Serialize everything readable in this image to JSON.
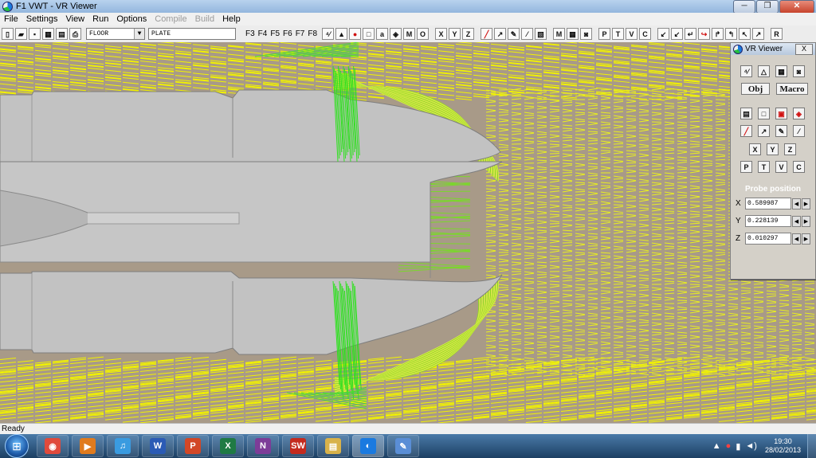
{
  "window": {
    "title": "F1 VWT - VR Viewer",
    "minimize": "─",
    "maximize": "❐",
    "close": "✕"
  },
  "menu": [
    {
      "label": "File",
      "enabled": true
    },
    {
      "label": "Settings",
      "enabled": true
    },
    {
      "label": "View",
      "enabled": true
    },
    {
      "label": "Run",
      "enabled": true
    },
    {
      "label": "Options",
      "enabled": true
    },
    {
      "label": "Compile",
      "enabled": false
    },
    {
      "label": "Build",
      "enabled": false
    },
    {
      "label": "Help",
      "enabled": true
    }
  ],
  "toolbar": {
    "file_buttons": [
      {
        "name": "new-file-icon",
        "glyph": "▯"
      },
      {
        "name": "open-folder-icon",
        "glyph": "▰"
      },
      {
        "name": "save-icon",
        "glyph": "▪"
      },
      {
        "name": "image-icon",
        "glyph": "▦"
      },
      {
        "name": "print-preview-icon",
        "glyph": "▤"
      },
      {
        "name": "print-icon",
        "glyph": "⎙"
      }
    ],
    "surface_select": "FLOOR",
    "object_field": "PLATE",
    "fkeys": [
      "F3",
      "F4",
      "F5",
      "F6",
      "F7",
      "F8"
    ],
    "tools": [
      {
        "name": "draw-mode-icon",
        "glyph": "⁴⁄"
      },
      {
        "name": "paint-icon",
        "glyph": "▲"
      },
      {
        "name": "red-marker-icon",
        "glyph": "●"
      },
      {
        "name": "select-box-icon",
        "glyph": "□"
      },
      {
        "name": "lock-icon",
        "glyph": "a"
      },
      {
        "name": "cube-icon",
        "glyph": "◈"
      },
      {
        "name": "m-button",
        "glyph": "M"
      },
      {
        "name": "o-button",
        "glyph": "O"
      },
      {
        "name": "x-axis-button",
        "glyph": "X"
      },
      {
        "name": "y-axis-button",
        "glyph": "Y"
      },
      {
        "name": "z-axis-button",
        "glyph": "Z"
      },
      {
        "name": "red-brush-icon",
        "glyph": "╱"
      },
      {
        "name": "arrow-tool-icon",
        "glyph": "↗"
      },
      {
        "name": "pencil-icon",
        "glyph": "✎"
      },
      {
        "name": "brush-icon",
        "glyph": "⁄"
      },
      {
        "name": "box-3d-icon",
        "glyph": "▧"
      },
      {
        "name": "macro-m-button",
        "glyph": "M"
      },
      {
        "name": "grid-icon",
        "glyph": "▦"
      },
      {
        "name": "camera-icon",
        "glyph": "◙"
      },
      {
        "name": "p-button",
        "glyph": "P"
      },
      {
        "name": "t-button",
        "glyph": "T"
      },
      {
        "name": "v-button",
        "glyph": "V"
      },
      {
        "name": "c-button",
        "glyph": "C"
      },
      {
        "name": "rotate-left-icon",
        "glyph": "↙"
      },
      {
        "name": "rotate-down-icon",
        "glyph": "↙"
      },
      {
        "name": "undo-icon",
        "glyph": "↵"
      },
      {
        "name": "redo-icon",
        "glyph": "↪"
      },
      {
        "name": "turn-icon",
        "glyph": "↱"
      },
      {
        "name": "turn-back-icon",
        "glyph": "↰"
      },
      {
        "name": "diag-up-left-icon",
        "glyph": "↖"
      },
      {
        "name": "diag-up-right-icon",
        "glyph": "↗"
      },
      {
        "name": "reset-button",
        "glyph": "R"
      }
    ]
  },
  "vr_panel": {
    "title": "VR Viewer",
    "close": "X",
    "row1": [
      {
        "name": "panel-draw-icon",
        "glyph": "⁴⁄"
      },
      {
        "name": "panel-triangle-icon",
        "glyph": "△"
      },
      {
        "name": "panel-grid-icon",
        "glyph": "▦"
      },
      {
        "name": "panel-camera-icon",
        "glyph": "◙"
      }
    ],
    "obj_label": "Obj",
    "macro_label": "Macro",
    "row3": [
      {
        "name": "panel-film-icon",
        "glyph": "▤"
      },
      {
        "name": "panel-box-icon",
        "glyph": "□"
      },
      {
        "name": "panel-red-box-icon",
        "glyph": "▣"
      },
      {
        "name": "panel-red-cube-icon",
        "glyph": "◈"
      }
    ],
    "row4": [
      {
        "name": "panel-red-brush-icon",
        "glyph": "╱"
      },
      {
        "name": "panel-arrow-icon",
        "glyph": "↗"
      },
      {
        "name": "panel-pencil-icon",
        "glyph": "✎"
      },
      {
        "name": "panel-brush-icon",
        "glyph": "⁄"
      }
    ],
    "axes": [
      "X",
      "Y",
      "Z"
    ],
    "ptvc": [
      "P",
      "T",
      "V",
      "C"
    ],
    "probe": {
      "title": "Probe position",
      "x_label": "X",
      "x_value": "0.589987",
      "y_label": "Y",
      "y_value": "0.228139",
      "z_label": "Z",
      "z_value": "0.010297"
    }
  },
  "status": "Ready",
  "taskbar": {
    "apps": [
      {
        "name": "chrome-taskbar-icon",
        "glyph": "◉",
        "color": "#e04a3c"
      },
      {
        "name": "media-player-taskbar-icon",
        "glyph": "▶",
        "color": "#e07b1e"
      },
      {
        "name": "itunes-taskbar-icon",
        "glyph": "♫",
        "color": "#3a9be0"
      },
      {
        "name": "word-taskbar-icon",
        "glyph": "W",
        "color": "#2b5bb5"
      },
      {
        "name": "powerpoint-taskbar-icon",
        "glyph": "P",
        "color": "#d24726"
      },
      {
        "name": "excel-taskbar-icon",
        "glyph": "X",
        "color": "#1f7a44"
      },
      {
        "name": "onenote-taskbar-icon",
        "glyph": "N",
        "color": "#7d3c98"
      },
      {
        "name": "solidworks-taskbar-icon",
        "glyph": "SW",
        "color": "#c42a1e"
      },
      {
        "name": "explorer-taskbar-icon",
        "glyph": "▤",
        "color": "#d8b24a"
      },
      {
        "name": "vr-viewer-taskbar-icon",
        "glyph": "◐",
        "color": "#1a7ae0"
      },
      {
        "name": "paint-taskbar-icon",
        "glyph": "✎",
        "color": "#5a8ed6"
      }
    ],
    "tray": {
      "up_arrow": "▲",
      "antivirus": "●",
      "network": "▮",
      "volume": "◄)",
      "time": "19:30",
      "date": "28/02/2013"
    }
  }
}
